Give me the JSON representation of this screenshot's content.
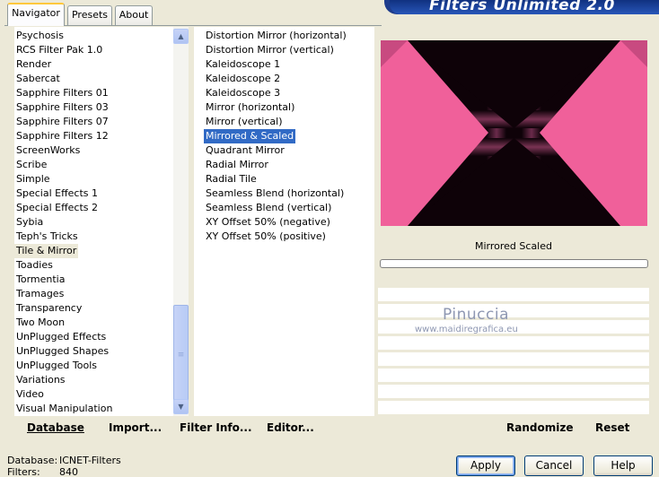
{
  "tabs": [
    {
      "label": "Navigator"
    },
    {
      "label": "Presets"
    },
    {
      "label": "About"
    }
  ],
  "banner_title": "Filters Unlimited 2.0",
  "categories": [
    "Psychosis",
    "RCS Filter Pak 1.0",
    "Render",
    "Sabercat",
    "Sapphire Filters 01",
    "Sapphire Filters 03",
    "Sapphire Filters 07",
    "Sapphire Filters 12",
    "ScreenWorks",
    "Scribe",
    "Simple",
    "Special Effects 1",
    "Special Effects 2",
    "Sybia",
    "Teph's Tricks",
    "Tile & Mirror",
    "Toadies",
    "Tormentia",
    "Tramages",
    "Transparency",
    "Two Moon",
    "UnPlugged Effects",
    "UnPlugged Shapes",
    "UnPlugged Tools",
    "Variations",
    "Video",
    "Visual Manipulation"
  ],
  "selected_category": "Tile & Mirror",
  "filters": [
    "Distortion Mirror (horizontal)",
    "Distortion Mirror (vertical)",
    "Kaleidoscope 1",
    "Kaleidoscope 2",
    "Kaleidoscope 3",
    "Mirror (horizontal)",
    "Mirror (vertical)",
    "Mirrored & Scaled",
    "Quadrant Mirror",
    "Radial Mirror",
    "Radial Tile",
    "Seamless Blend (horizontal)",
    "Seamless Blend (vertical)",
    "XY Offset 50% (negative)",
    "XY Offset 50% (positive)"
  ],
  "selected_filter": "Mirrored & Scaled",
  "preview_filter_name": "Mirrored  Scaled",
  "watermark": {
    "name": "Pinuccia",
    "url": "www.maidiregrafica.eu"
  },
  "bottom_left_buttons": {
    "database": "Database",
    "import": "Import...",
    "filter_info": "Filter Info...",
    "editor": "Editor..."
  },
  "bottom_right_buttons": {
    "randomize": "Randomize",
    "reset": "Reset"
  },
  "status": {
    "database_label": "Database:",
    "database_value": "ICNET-Filters",
    "filters_label": "Filters:",
    "filters_value": "840"
  },
  "dialog_buttons": {
    "apply": "Apply",
    "cancel": "Cancel",
    "help": "Help"
  },
  "colors": {
    "preview_pink": "#f0609a",
    "preview_dark": "#0e0208",
    "selection": "#316ac5",
    "window_bg": "#ece9d8"
  }
}
